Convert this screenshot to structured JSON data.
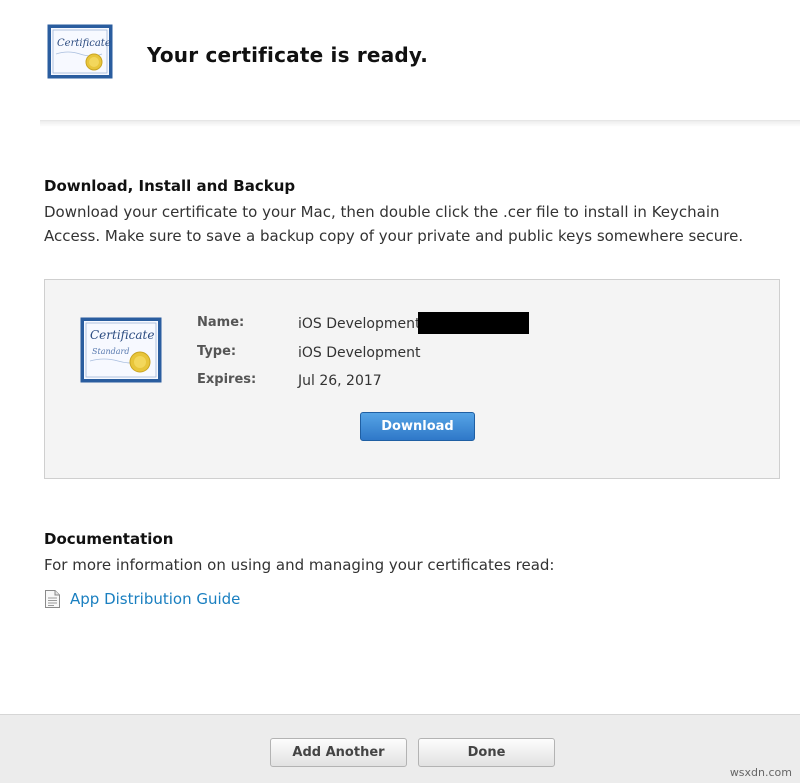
{
  "header": {
    "title": "Your certificate is ready.",
    "icon_word": "Certificate"
  },
  "download_section": {
    "title": "Download, Install and Backup",
    "description": "Download your certificate to your Mac, then double click the .cer file to install in Keychain Access. Make sure to save a backup copy of your private and public keys somewhere secure."
  },
  "certificate": {
    "icon_word": "Certificate",
    "icon_subword": "Standard",
    "fields": {
      "name_label": "Name:",
      "name_value": "iOS Development:",
      "type_label": "Type:",
      "type_value": "iOS Development",
      "expires_label": "Expires:",
      "expires_value": "Jul 26, 2017"
    },
    "download_label": "Download"
  },
  "documentation": {
    "title": "Documentation",
    "description": "For more information on using and managing your certificates read:",
    "link_label": "App Distribution Guide",
    "link_icon": "document-icon"
  },
  "footer": {
    "add_another_label": "Add Another",
    "done_label": "Done"
  },
  "watermark": "wsxdn.com",
  "colors": {
    "accent_blue": "#2f78c8",
    "link_blue": "#1a7fc0",
    "box_background": "#f4f4f4",
    "footer_background": "#ececec",
    "certificate_border": "#2a5d9f",
    "seal_gold": "#e8c53a"
  }
}
